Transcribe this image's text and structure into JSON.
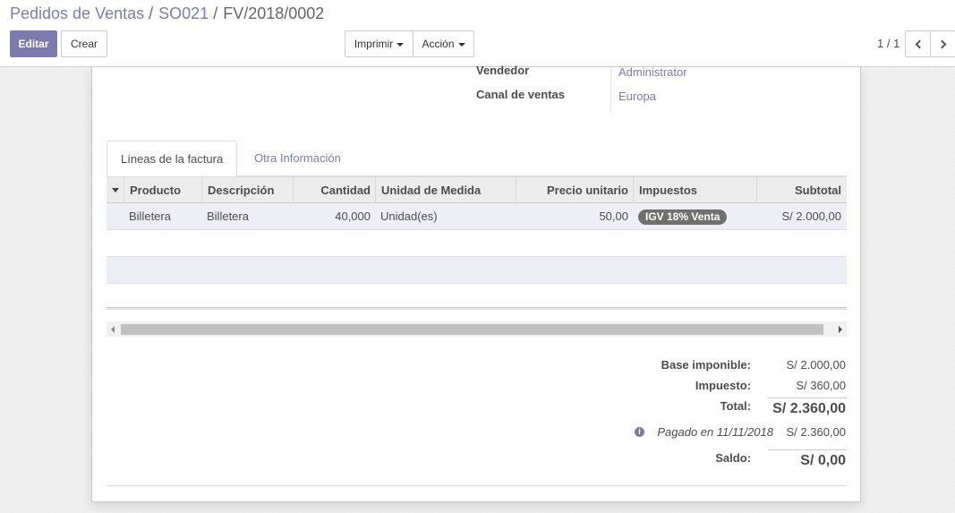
{
  "breadcrumb": {
    "items": [
      "Pedidos de Ventas",
      "SO021"
    ],
    "separator": "/",
    "current": "FV/2018/0002"
  },
  "toolbar": {
    "edit_label": "Editar",
    "create_label": "Crear",
    "print_label": "Imprimir",
    "action_label": "Acción"
  },
  "pager": {
    "value": "1 / 1",
    "prev_icon": "chevron-left-icon",
    "next_icon": "chevron-right-icon"
  },
  "form": {
    "fields": [
      {
        "label": "Vendedor",
        "value": "Administrator"
      },
      {
        "label": "Canal de ventas",
        "value": "Europa"
      }
    ]
  },
  "tabs": [
    {
      "label": "Líneas de la factura",
      "active": true
    },
    {
      "label": "Otra Información",
      "active": false
    }
  ],
  "invoice_lines": {
    "columns": [
      "Producto",
      "Descripción",
      "Cantidad",
      "Unidad de Medida",
      "Precio unitario",
      "Impuestos",
      "Subtotal"
    ],
    "rows": [
      {
        "producto": "Billetera",
        "descripcion": "Billetera",
        "cantidad": "40,000",
        "unidad": "Unidad(es)",
        "precio": "50,00",
        "impuestos": "IGV 18% Venta",
        "subtotal": "S/ 2.000,00"
      }
    ]
  },
  "totals": {
    "base_label": "Base imponible:",
    "base_value": "S/ 2.000,00",
    "tax_label": "Impuesto:",
    "tax_value": "S/ 360,00",
    "total_label": "Total:",
    "total_value": "S/ 2.360,00",
    "payment_label": "Pagado en 11/11/2018",
    "payment_value": "S/ 2.360,00",
    "balance_label": "Saldo:",
    "balance_value": "S/ 0,00",
    "info_icon": "info-icon"
  },
  "colors": {
    "accent": "#7c7bad",
    "badge": "#707070",
    "row_highlight": "#eeeef6"
  }
}
